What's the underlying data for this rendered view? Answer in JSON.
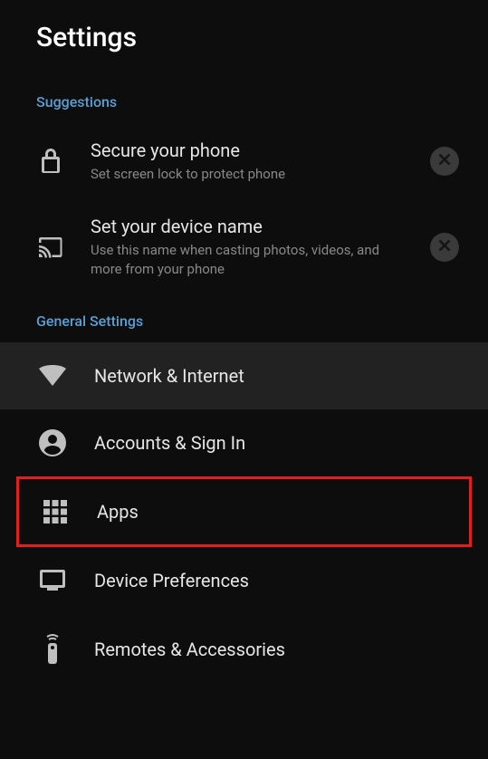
{
  "header": {
    "title": "Settings"
  },
  "suggestions": {
    "header": "Suggestions",
    "items": [
      {
        "title": "Secure your phone",
        "description": "Set screen lock to protect phone"
      },
      {
        "title": "Set your device name",
        "description": "Use this name when casting photos, videos, and more from your phone"
      }
    ]
  },
  "general": {
    "header": "General Settings",
    "items": [
      {
        "label": "Network & Internet"
      },
      {
        "label": "Accounts & Sign In"
      },
      {
        "label": "Apps"
      },
      {
        "label": "Device Preferences"
      },
      {
        "label": "Remotes & Accessories"
      }
    ]
  }
}
